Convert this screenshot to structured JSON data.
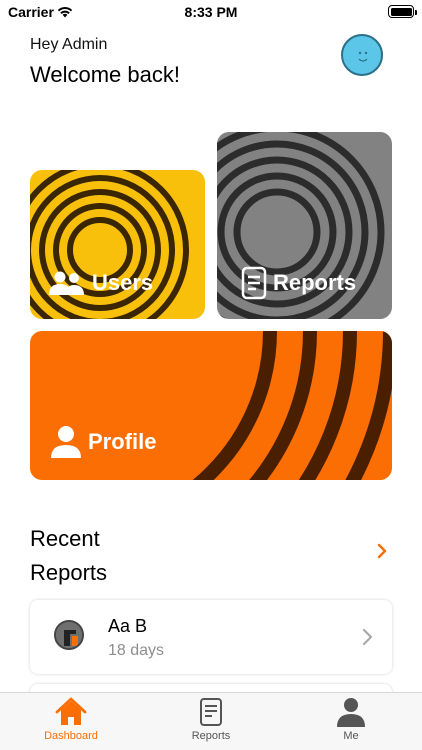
{
  "status_bar": {
    "carrier": "Carrier",
    "time": "8:33 PM"
  },
  "header": {
    "greeting": "Hey Admin",
    "welcome": "Welcome back!"
  },
  "cards": {
    "users": {
      "label": "Users",
      "color": "#f9c00b",
      "icon": "users-icon"
    },
    "reports": {
      "label": "Reports",
      "color": "#828282",
      "icon": "document-icon"
    },
    "profile": {
      "label": "Profile",
      "color": "#fa6e04",
      "icon": "person-icon"
    }
  },
  "recent": {
    "title_line1": "Recent",
    "title_line2": "Reports",
    "accent": "#fa6e04",
    "items": [
      {
        "title": "Aa B",
        "subtitle": "18 days"
      }
    ]
  },
  "tabs": [
    {
      "label": "Dashboard",
      "icon": "home-icon",
      "active": true
    },
    {
      "label": "Reports",
      "icon": "document-icon",
      "active": false
    },
    {
      "label": "Me",
      "icon": "person-icon",
      "active": false
    }
  ]
}
